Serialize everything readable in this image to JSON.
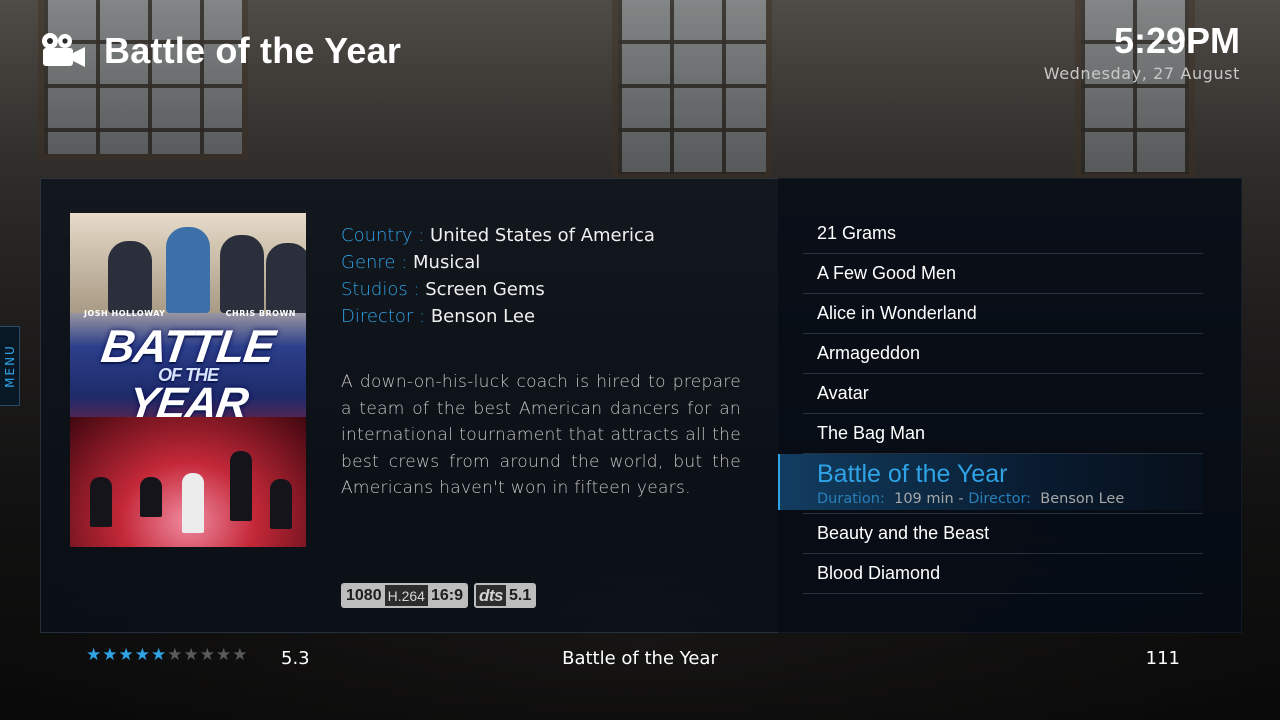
{
  "header": {
    "icon": "movie-camera-icon",
    "title": "Battle of the Year",
    "time": "5:29PM",
    "date": "Wednesday, 27 August"
  },
  "side_menu": {
    "label": "MENU"
  },
  "poster": {
    "actor_left": "JOSH HOLLOWAY",
    "actor_right": "CHRIS BROWN",
    "title_line1": "BATTLE",
    "title_line2": "OF THE",
    "title_line3": "YEAR"
  },
  "details": {
    "country_label": "Country :",
    "country": "United States of America",
    "genre_label": "Genre :",
    "genre": "Musical",
    "studios_label": "Studios :",
    "studios": "Screen Gems",
    "director_label": "Director :",
    "director": "Benson Lee",
    "plot": "A down-on-his-luck coach is hired to prepare a team of the best American dancers for an international tournament that attracts all the best crews from around the world, but the Americans haven't won in fifteen years."
  },
  "media_flags": {
    "resolution": "1080",
    "codec": "H.264",
    "aspect": "16:9",
    "audio_codec": "dts",
    "channels": "5.1"
  },
  "movie_list": {
    "items": [
      {
        "title": "21 Grams"
      },
      {
        "title": "A Few Good Men"
      },
      {
        "title": "Alice in Wonderland"
      },
      {
        "title": "Armageddon"
      },
      {
        "title": "Avatar"
      },
      {
        "title": "The Bag Man"
      },
      {
        "title": "Battle of the Year",
        "selected": true
      },
      {
        "title": "Beauty and the Beast"
      },
      {
        "title": "Blood Diamond"
      }
    ],
    "selected": {
      "duration_label": "Duration:",
      "duration": "109 min",
      "separator": "-",
      "director_label": "Director:",
      "director": "Benson Lee"
    }
  },
  "footer": {
    "rating_value": 5.3,
    "rating_text": "5.3",
    "rating_max": 10,
    "stars_filled": 5,
    "title": "Battle of the Year",
    "count": "111"
  },
  "colors": {
    "accent": "#2fa3e6",
    "panel": "#0a101a",
    "text": "#ffffff"
  }
}
